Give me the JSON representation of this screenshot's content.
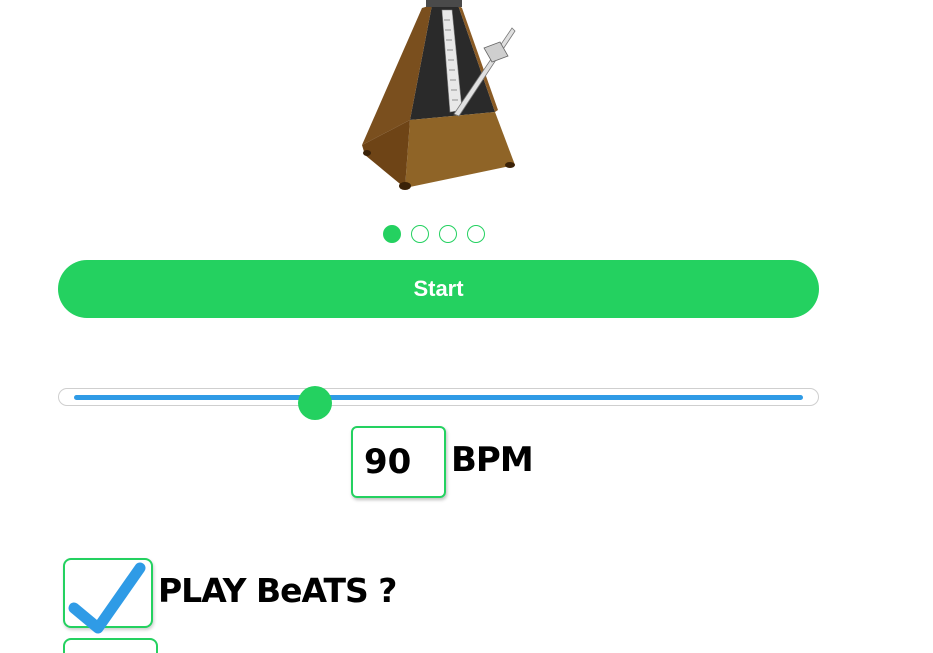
{
  "metronome": {
    "image_icon": "metronome-icon"
  },
  "beats": {
    "count": 4,
    "active_index": 0
  },
  "start_button": {
    "label": "Start"
  },
  "tempo_slider": {
    "value_fraction": 0.33
  },
  "bpm": {
    "value": "90",
    "unit_label": "BPM"
  },
  "play_beats": {
    "checked": true,
    "label": "PLAY BeATS ?"
  },
  "colors": {
    "accent_green": "#24d160",
    "slider_blue": "#2f9be6",
    "check_blue": "#2f9be6"
  }
}
